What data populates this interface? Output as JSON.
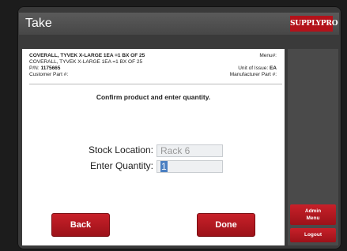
{
  "header": {
    "title": "Take",
    "logo_text": "SUPPLYPRO"
  },
  "product": {
    "line1": "COVERALL, TYVEK  X-LARGE 1EA =1 BX OF 25",
    "line2": "COVERALL, TYVEK  X-LARGE 1EA =1 BX OF 25",
    "pn_label": "P/N:",
    "pn_value": "1175665",
    "customer_part_label": "Customer Part #:",
    "menu_label": "Menu#:",
    "unit_label": "Unit of Issue:",
    "unit_value": "EA",
    "manufacturer_part_label": "Manufacturer Part #:"
  },
  "form": {
    "prompt": "Confirm product and enter quantity.",
    "stock_location_label": "Stock Location:",
    "stock_location_value": "Rack 6",
    "quantity_label": "Enter Quantity:",
    "quantity_value": "1"
  },
  "buttons": {
    "back": "Back",
    "done": "Done",
    "admin_menu": "Admin\nMenu",
    "logout": "Logout"
  },
  "colors": {
    "accent": "#b3121a",
    "header": "#4f4f4f",
    "sidebar": "#4a4a4a"
  }
}
